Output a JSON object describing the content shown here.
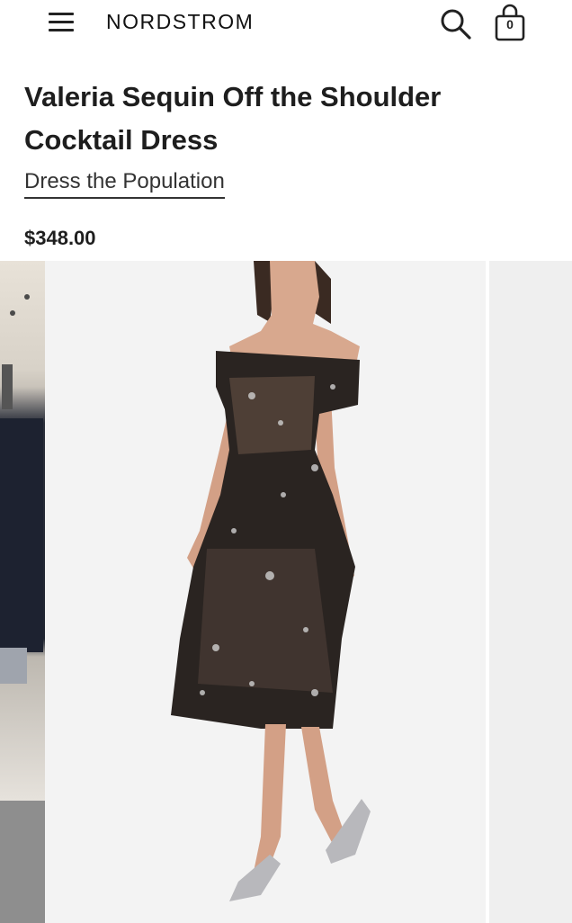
{
  "header": {
    "logo": "NORDSTROM",
    "menu_icon": "hamburger-menu-icon",
    "search_icon": "search-icon",
    "bag_icon": "shopping-bag-icon",
    "bag_count": "0"
  },
  "product": {
    "title": "Valeria Sequin Off the Shoulder Cocktail Dress",
    "brand": "Dress the Population",
    "price": "$348.00"
  },
  "gallery": {
    "images": [
      "store-preview-image",
      "dress-model-image",
      "next-preview-image"
    ]
  },
  "colors": {
    "text": "#1e1e1e",
    "background": "#ffffff",
    "image_bg": "#f3f3f3"
  }
}
